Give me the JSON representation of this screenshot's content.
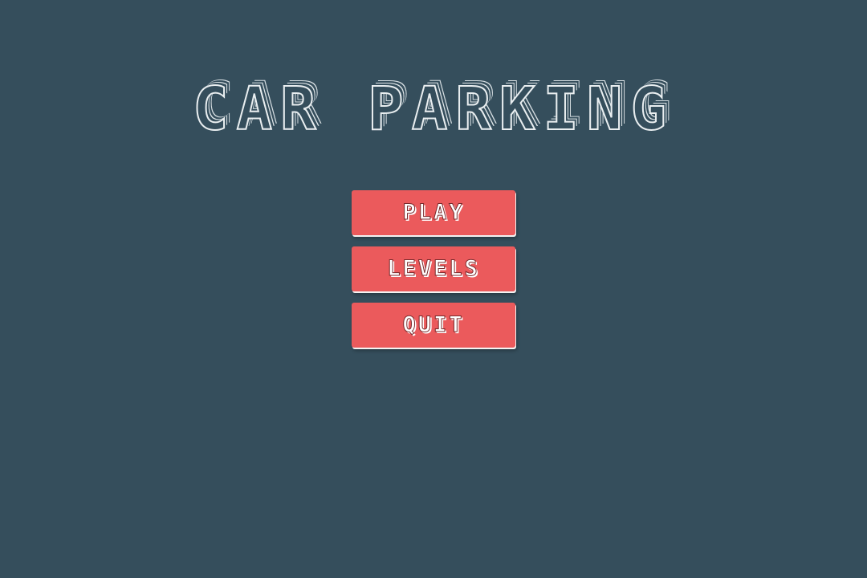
{
  "game": {
    "title": "CAR PARKING"
  },
  "menu": {
    "buttons": [
      {
        "label": "PLAY"
      },
      {
        "label": "LEVELS"
      },
      {
        "label": "QUIT"
      }
    ]
  },
  "colors": {
    "background": "#354e5c",
    "button": "#eb5a5c",
    "title_outline": "#e9eef0",
    "button_text": "#ffffff"
  }
}
